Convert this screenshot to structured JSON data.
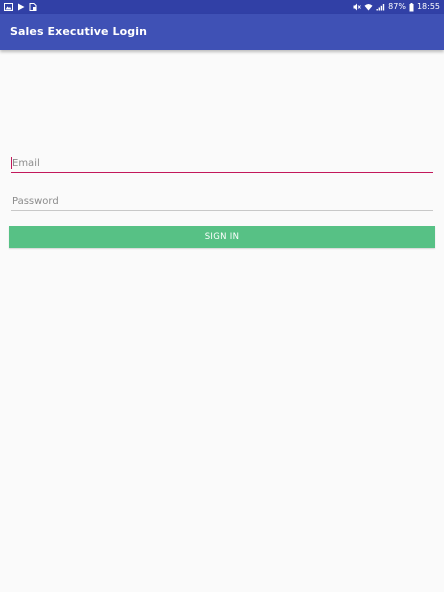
{
  "status_bar": {
    "left_icons": [
      "gallery-icon",
      "play-store-icon",
      "document-icon"
    ],
    "right_icons": [
      "mute-icon",
      "wifi-icon",
      "signal-icon",
      "battery-icon"
    ],
    "battery_percent": "87%",
    "time": "18:55"
  },
  "app_bar": {
    "title": "Sales Executive Login"
  },
  "form": {
    "email_placeholder": "Email",
    "email_value": "",
    "password_placeholder": "Password",
    "password_value": "",
    "signin_label": "SIGN IN"
  },
  "colors": {
    "status_bar": "#3140a6",
    "app_bar": "#3f51b5",
    "focus_underline": "#c2185b",
    "idle_underline": "#c8c8c8",
    "signin_button": "#57c185",
    "background": "#fafafa"
  }
}
